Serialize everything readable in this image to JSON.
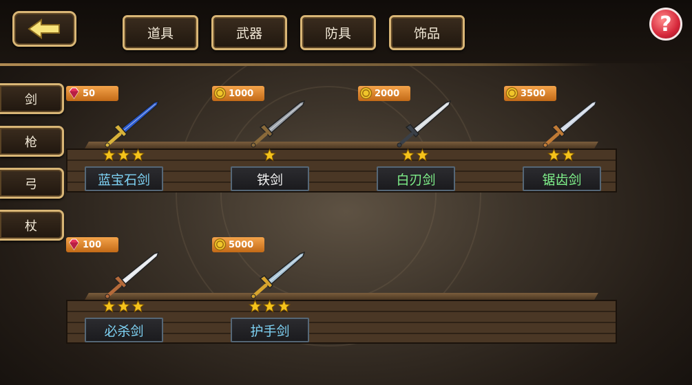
{
  "nav": {
    "back_icon": "left-arrow-icon",
    "tabs": [
      "道具",
      "武器",
      "防具",
      "饰品"
    ],
    "help_icon": "question-mark-icon",
    "help_label": "?"
  },
  "categories": [
    "剑",
    "枪",
    "弓",
    "杖"
  ],
  "colors": {
    "button_border": "#d9b676",
    "price_tag": "#e58a2c",
    "name_blue": "#7fd3f5",
    "name_white": "#f2f2f2",
    "name_green": "#7ff08a",
    "star": "#f5c31c",
    "help_red": "#d6283b"
  },
  "items": [
    {
      "name": "蓝宝石剑",
      "currency": "gem-icon",
      "price": "50",
      "stars": 3,
      "name_color": "#7fd3f5",
      "blade": "#2a5ad0",
      "hilt": "#d8b23a"
    },
    {
      "name": "铁剑",
      "currency": "coin-icon",
      "price": "1000",
      "stars": 1,
      "name_color": "#f2f2f2",
      "blade": "#9aa0a8",
      "hilt": "#8a6a3a"
    },
    {
      "name": "白刃剑",
      "currency": "coin-icon",
      "price": "2000",
      "stars": 2,
      "name_color": "#7ff08a",
      "blade": "#d8dde2",
      "hilt": "#3a4048"
    },
    {
      "name": "锯齿剑",
      "currency": "coin-icon",
      "price": "3500",
      "stars": 2,
      "name_color": "#7ff08a",
      "blade": "#cfd8e6",
      "hilt": "#c07a35"
    },
    {
      "name": "必杀剑",
      "currency": "gem-icon",
      "price": "100",
      "stars": 3,
      "name_color": "#7fd3f5",
      "blade": "#e6e9ee",
      "hilt": "#b56a3a"
    },
    {
      "name": "护手剑",
      "currency": "coin-icon",
      "price": "5000",
      "stars": 3,
      "name_color": "#7fd3f5",
      "blade": "#a9c4d6",
      "hilt": "#d7a42e"
    }
  ]
}
